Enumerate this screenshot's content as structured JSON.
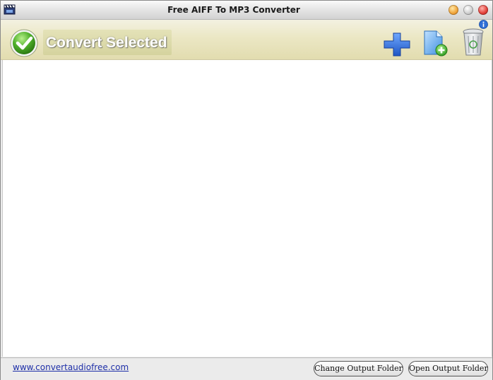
{
  "window": {
    "title": "Free AIFF To MP3 Converter",
    "app_icon": "clapperboard-icon",
    "controls": [
      "minimize-icon",
      "maximize-icon",
      "close-icon"
    ]
  },
  "toolbar": {
    "convert_label": "Convert Selected",
    "convert_icon": "checkmark-icon",
    "info_icon": "info-icon",
    "tools": [
      {
        "name": "add-files",
        "icon": "plus-icon"
      },
      {
        "name": "add-folder",
        "icon": "document-add-icon"
      },
      {
        "name": "delete",
        "icon": "trash-icon"
      }
    ]
  },
  "file_list": {
    "items": []
  },
  "footer": {
    "link_text": "www.convertaudiofree.com",
    "change_output_label": "Change Output Folder",
    "open_output_label": "Open Output Folder"
  },
  "colors": {
    "toolbar_bg": "#ebe7c4",
    "accent_green": "#4fb02a",
    "accent_blue": "#2f6fd6",
    "link": "#1e2fa8"
  }
}
